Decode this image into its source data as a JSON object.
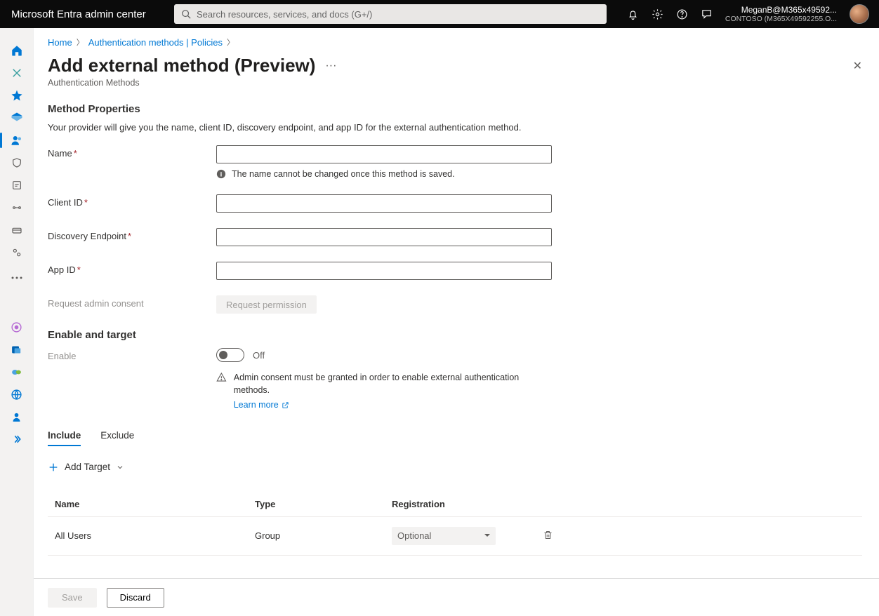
{
  "brand": "Microsoft Entra admin center",
  "search": {
    "placeholder": "Search resources, services, and docs (G+/)"
  },
  "user": {
    "name": "MeganB@M365x49592...",
    "tenant": "CONTOSO (M365X49592255.O..."
  },
  "breadcrumb": {
    "home": "Home",
    "auth": "Authentication methods | Policies"
  },
  "page": {
    "title": "Add external method (Preview)",
    "subtitle": "Authentication Methods"
  },
  "section1": {
    "heading": "Method Properties",
    "desc": "Your provider will give you the name, client ID, discovery endpoint, and app ID for the external authentication method.",
    "name_label": "Name",
    "name_help": "The name cannot be changed once this method is saved.",
    "client_id_label": "Client ID",
    "discovery_label": "Discovery Endpoint",
    "appid_label": "App ID",
    "consent_label": "Request admin consent",
    "consent_button": "Request permission"
  },
  "section2": {
    "heading": "Enable and target",
    "enable_label": "Enable",
    "toggle_state": "Off",
    "warning": "Admin consent must be granted in order to enable external authentication methods.",
    "learn_more": "Learn more"
  },
  "tabs": {
    "include": "Include",
    "exclude": "Exclude"
  },
  "add_target": "Add Target",
  "table": {
    "headers": {
      "name": "Name",
      "type": "Type",
      "reg": "Registration"
    },
    "row": {
      "name": "All Users",
      "type": "Group",
      "reg": "Optional"
    }
  },
  "footer": {
    "save": "Save",
    "discard": "Discard"
  }
}
